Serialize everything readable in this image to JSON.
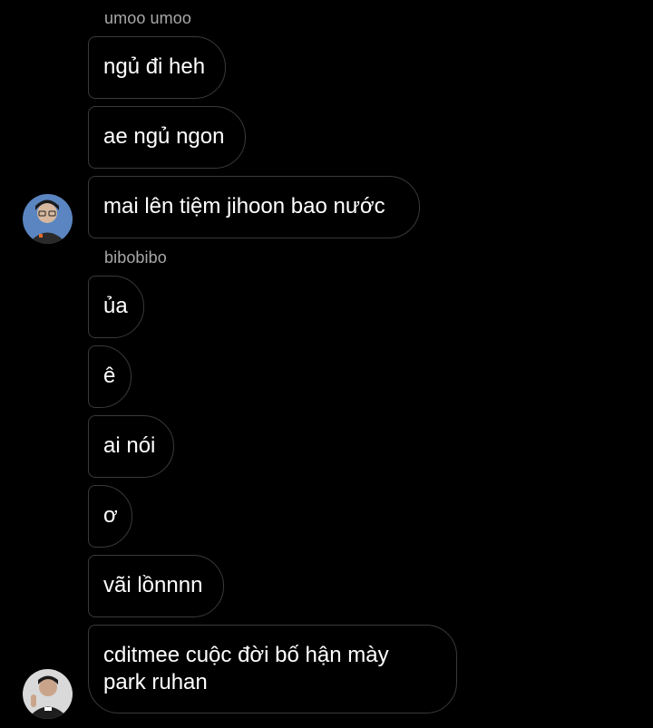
{
  "colors": {
    "background": "#000000",
    "bubble_border": "#3a3a3a",
    "sender_name": "#a8a8a8",
    "text": "#ffffff"
  },
  "groups": [
    {
      "sender": "umoo umoo",
      "avatar": "person-avatar-1",
      "messages": [
        "ngủ đi heh",
        "ae ngủ ngon",
        "mai lên tiệm jihoon bao nước"
      ]
    },
    {
      "sender": "bibobibo",
      "avatar": "person-avatar-2",
      "messages": [
        "ủa",
        "ê",
        "ai nói",
        "ơ",
        "vãi lồnnnn",
        "cditmee cuộc đời bố hận mày park ruhan"
      ]
    }
  ]
}
